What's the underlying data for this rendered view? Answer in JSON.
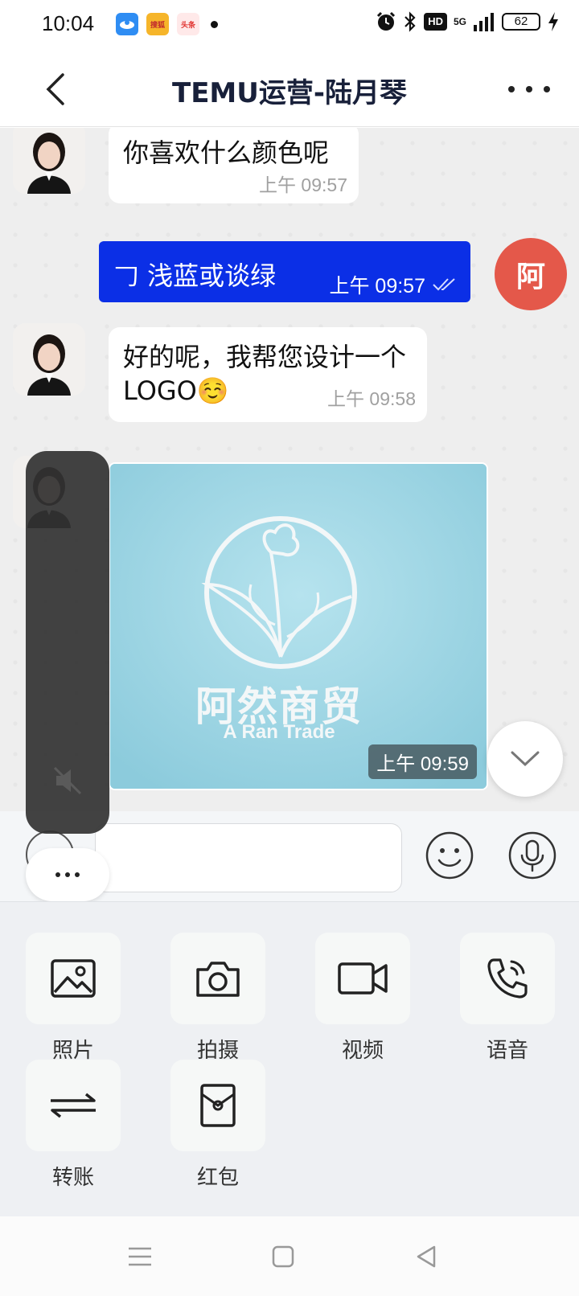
{
  "status_bar": {
    "time": "10:04",
    "notifications": [
      "baidu-map",
      "sohu-news",
      "toutiao"
    ],
    "notification_labels": [
      "",
      "搜狐",
      "头条"
    ],
    "network": "5G",
    "battery": "62",
    "hd": "HD"
  },
  "header": {
    "title": "TEMU运营-陆月琴"
  },
  "messages": [
    {
      "side": "in",
      "text": "你喜欢什么颜色呢",
      "time": "上午  09:57"
    },
    {
      "side": "out",
      "text": "𠃌 浅蓝或谈绿",
      "time": "上午  09:57",
      "avatar_text": "阿"
    },
    {
      "side": "in",
      "text": "好的呢，我帮您设计一个LOGO☺️",
      "time": "上午  09:58"
    },
    {
      "side": "in",
      "type": "image",
      "logo_cn": "阿然商贸",
      "logo_en": "A Ran Trade",
      "time": "上午  09:59"
    }
  ],
  "input": {
    "placeholder": ""
  },
  "tools": [
    {
      "label": "照片",
      "icon": "photo-icon"
    },
    {
      "label": "拍摄",
      "icon": "camera-icon"
    },
    {
      "label": "视频",
      "icon": "video-icon"
    },
    {
      "label": "语音",
      "icon": "voice-call-icon"
    },
    {
      "label": "转账",
      "icon": "transfer-icon"
    },
    {
      "label": "红包",
      "icon": "red-packet-icon"
    }
  ],
  "colors": {
    "outgoing_bubble": "#0b2fe6",
    "my_avatar": "#e4584a",
    "image_bg": "#a8dbe8"
  }
}
